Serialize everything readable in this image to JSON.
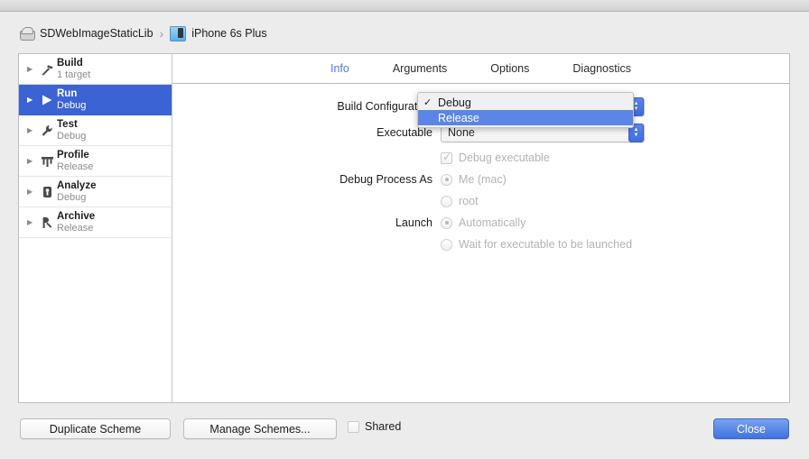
{
  "breadcrumb": {
    "scheme_icon": "scheme-icon",
    "scheme": "SDWebImageStaticLib",
    "separator": "›",
    "device_icon": "device-icon",
    "device": "iPhone 6s Plus"
  },
  "sidebar": {
    "items": [
      {
        "title": "Build",
        "subtitle": "1 target",
        "icon": "hammer-icon",
        "glyph": "⚒",
        "selected": false
      },
      {
        "title": "Run",
        "subtitle": "Debug",
        "icon": "play-icon",
        "glyph": "▶",
        "selected": true
      },
      {
        "title": "Test",
        "subtitle": "Debug",
        "icon": "wrench-icon",
        "glyph": "ὒ7",
        "selected": false
      },
      {
        "title": "Profile",
        "subtitle": "Release",
        "icon": "gauge-icon",
        "glyph": "⚕",
        "selected": false
      },
      {
        "title": "Analyze",
        "subtitle": "Debug",
        "icon": "magnifier-icon",
        "glyph": "▣",
        "selected": false
      },
      {
        "title": "Archive",
        "subtitle": "Release",
        "icon": "archive-icon",
        "glyph": "⛏",
        "selected": false
      }
    ],
    "disclosure_glyph": "▶"
  },
  "tabs": [
    {
      "label": "Info",
      "active": true
    },
    {
      "label": "Arguments",
      "active": false
    },
    {
      "label": "Options",
      "active": false
    },
    {
      "label": "Diagnostics",
      "active": false
    }
  ],
  "form": {
    "build_configuration": {
      "label": "Build Configuration",
      "value": "Debug"
    },
    "executable": {
      "label": "Executable",
      "value": "None"
    },
    "debug_executable": {
      "label": "Debug executable",
      "checked": true,
      "enabled": false
    },
    "debug_process_as": {
      "label": "Debug Process As",
      "options": [
        {
          "label": "Me (mac)",
          "selected": true
        },
        {
          "label": "root",
          "selected": false
        }
      ]
    },
    "launch": {
      "label": "Launch",
      "options": [
        {
          "label": "Automatically",
          "selected": true
        },
        {
          "label": "Wait for executable to be launched",
          "selected": false
        }
      ]
    }
  },
  "dropdown_menu": {
    "open": true,
    "check_glyph": "✓",
    "items": [
      {
        "label": "Debug",
        "checked": true,
        "highlighted": false
      },
      {
        "label": "Release",
        "checked": false,
        "highlighted": true
      }
    ]
  },
  "bottom_bar": {
    "duplicate_scheme": "Duplicate Scheme",
    "manage_schemes": "Manage Schemes...",
    "shared": {
      "label": "Shared",
      "checked": false
    },
    "close": "Close"
  },
  "colors": {
    "selection_blue": "#3b63d4",
    "menu_highlight": "#5c86e6",
    "active_tab": "#4a79e8",
    "disabled_text": "#b3b3b3"
  }
}
